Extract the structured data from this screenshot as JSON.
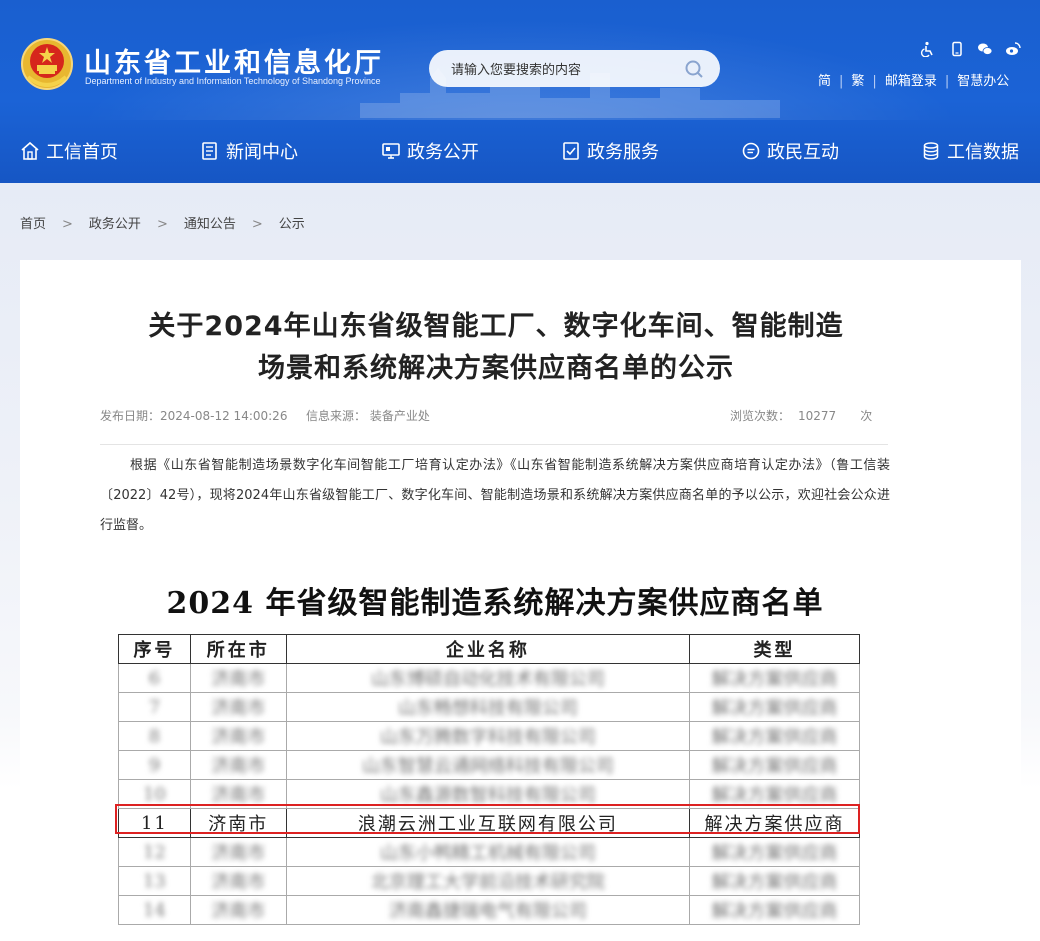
{
  "header": {
    "title": "山东省工业和信息化厅",
    "subtitle": "Department of Industry and Information Technology of Shandong Province",
    "search_placeholder": "请输入您要搜索的内容",
    "top_icons": [
      "accessibility-icon",
      "mobile-icon",
      "wechat-icon",
      "weibo-icon"
    ],
    "links": [
      "简",
      "繁",
      "邮箱登录",
      "智慧办公"
    ]
  },
  "nav": [
    {
      "label": "工信首页",
      "icon": "home-icon"
    },
    {
      "label": "新闻中心",
      "icon": "news-icon"
    },
    {
      "label": "政务公开",
      "icon": "monitor-icon"
    },
    {
      "label": "政务服务",
      "icon": "service-icon"
    },
    {
      "label": "政民互动",
      "icon": "chat-icon"
    },
    {
      "label": "工信数据",
      "icon": "database-icon"
    }
  ],
  "breadcrumb": [
    "首页",
    "政务公开",
    "通知公告",
    "公示"
  ],
  "article": {
    "title_line1": "关于2024年山东省级智能工厂、数字化车间、智能制造",
    "title_line2": "场景和系统解决方案供应商名单的公示",
    "publish_date": "发布日期：2024-08-12 14:00:26",
    "source": "信息来源：  装备产业处",
    "views_label": "浏览次数：",
    "views": "10277",
    "views_unit": "次",
    "body": "根据《山东省智能制造场景数字化车间智能工厂培育认定办法》《山东省智能制造系统解决方案供应商培育认定办法》（鲁工信装〔2022〕42号），现将2024年山东省级智能工厂、数字化车间、智能制造场景和系统解决方案供应商名单的予以公示，欢迎社会公众进行监督。"
  },
  "list": {
    "title": "2024 年省级智能制造系统解决方案供应商名单",
    "headers": [
      "序号",
      "所在市",
      "企业名称",
      "类型"
    ],
    "rows": [
      {
        "no": "6",
        "city": "济南市",
        "name": "山东博硕自动化技术有限公司",
        "type": "解决方案供应商",
        "blurred": true
      },
      {
        "no": "7",
        "city": "济南市",
        "name": "山东畅想科技有限公司",
        "type": "解决方案供应商",
        "blurred": true
      },
      {
        "no": "8",
        "city": "济南市",
        "name": "山东万腾数字科技有限公司",
        "type": "解决方案供应商",
        "blurred": true
      },
      {
        "no": "9",
        "city": "济南市",
        "name": "山东智慧云通网络科技有限公司",
        "type": "解决方案供应商",
        "blurred": true
      },
      {
        "no": "10",
        "city": "济南市",
        "name": "山东鑫源数智科技有限公司",
        "type": "解决方案供应商",
        "blurred": true
      },
      {
        "no": "11",
        "city": "济南市",
        "name": "浪潮云洲工业互联网有限公司",
        "type": "解决方案供应商",
        "blurred": false
      },
      {
        "no": "12",
        "city": "济南市",
        "name": "山东小鸭精工机械有限公司",
        "type": "解决方案供应商",
        "blurred": true
      },
      {
        "no": "13",
        "city": "济南市",
        "name": "北京理工大学前沿技术研究院",
        "type": "解决方案供应商",
        "blurred": true
      },
      {
        "no": "14",
        "city": "济南市",
        "name": "济南鑫捷瑞电气有限公司",
        "type": "解决方案供应商",
        "blurred": true
      }
    ]
  },
  "colors": {
    "header_blue": "#1b63d6",
    "highlight_red": "#dd2222"
  }
}
